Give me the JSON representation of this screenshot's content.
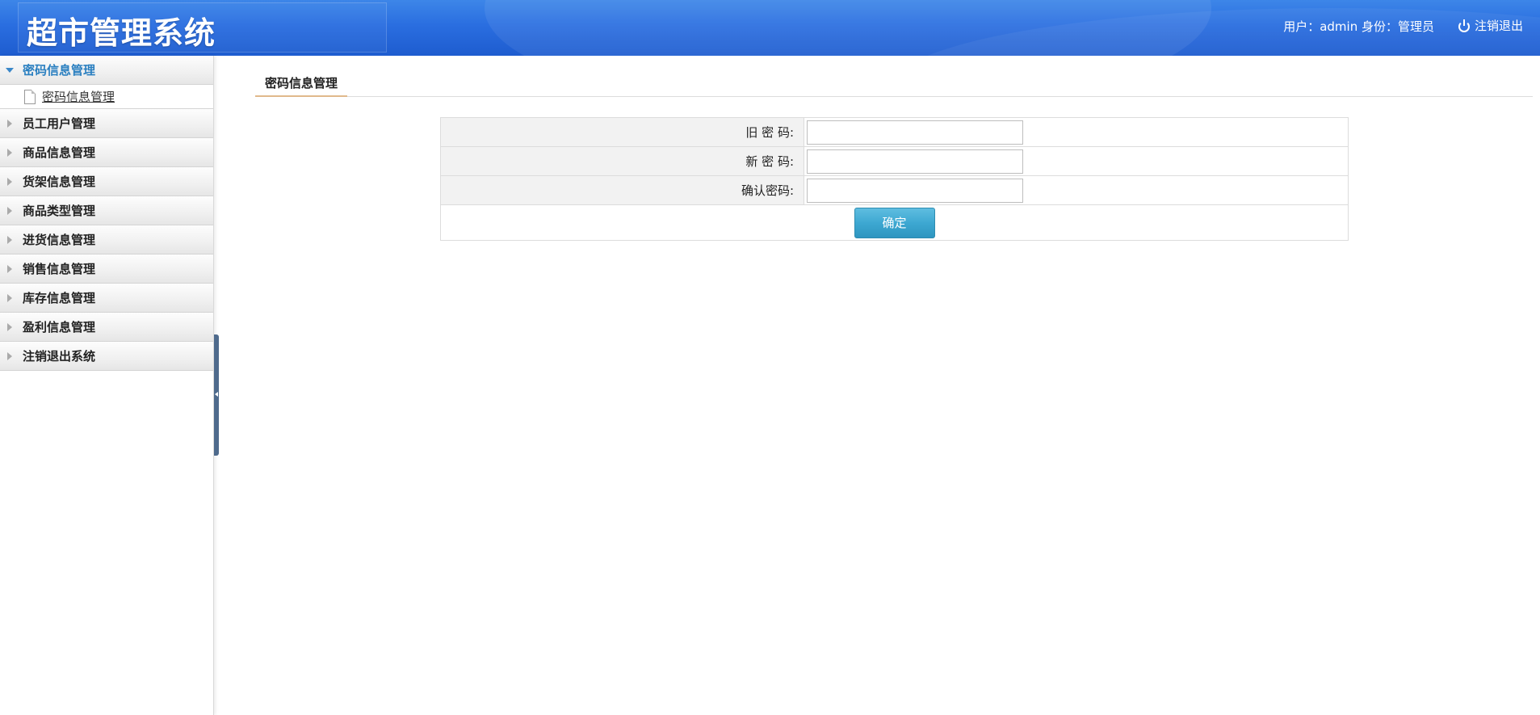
{
  "header": {
    "title": "超市管理系统",
    "user_info": "用户：admin 身份：管理员",
    "logout_label": "注销退出"
  },
  "sidebar": {
    "groups": [
      {
        "label": "密码信息管理",
        "open": true,
        "items": [
          {
            "label": "密码信息管理"
          }
        ]
      },
      {
        "label": "员工用户管理"
      },
      {
        "label": "商品信息管理"
      },
      {
        "label": "货架信息管理"
      },
      {
        "label": "商品类型管理"
      },
      {
        "label": "进货信息管理"
      },
      {
        "label": "销售信息管理"
      },
      {
        "label": "库存信息管理"
      },
      {
        "label": "盈利信息管理"
      },
      {
        "label": "注销退出系统"
      }
    ]
  },
  "main": {
    "tab_label": "密码信息管理",
    "form": {
      "old_password_label": "旧 密 码:",
      "old_password_value": "",
      "new_password_label": "新 密 码:",
      "new_password_value": "",
      "confirm_password_label": "确认密码:",
      "confirm_password_value": "",
      "submit_label": "确定"
    }
  },
  "colors": {
    "header_blue": "#2a6ee0",
    "active_menu": "#2a7fc0",
    "button": "#3da8d2",
    "splitter": "#4e6a8c"
  }
}
